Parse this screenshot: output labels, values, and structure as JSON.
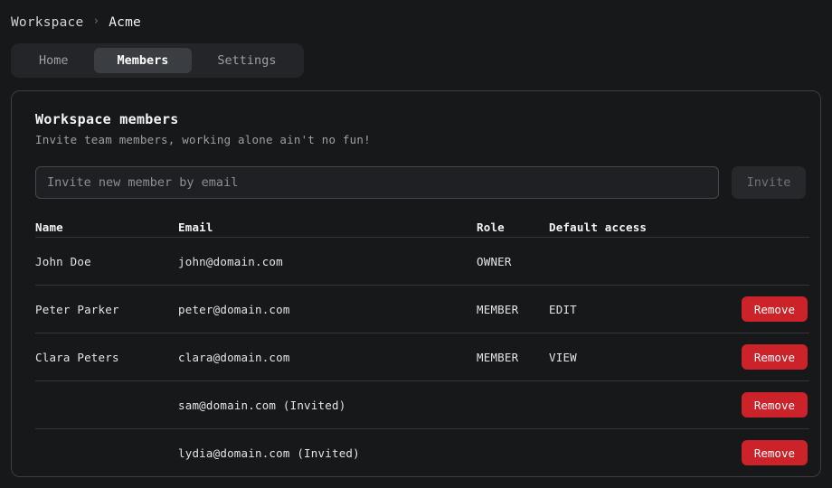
{
  "breadcrumb": {
    "root": "Workspace",
    "separator": "›",
    "current": "Acme"
  },
  "tabs": [
    {
      "label": "Home",
      "active": false
    },
    {
      "label": "Members",
      "active": true
    },
    {
      "label": "Settings",
      "active": false
    }
  ],
  "card": {
    "title": "Workspace members",
    "subtitle": "Invite team members, working alone ain't no fun!"
  },
  "invite": {
    "placeholder": "Invite new member by email",
    "value": "",
    "button_label": "Invite",
    "button_disabled": true
  },
  "table": {
    "headers": {
      "name": "Name",
      "email": "Email",
      "role": "Role",
      "access": "Default access",
      "action": ""
    },
    "rows": [
      {
        "name": "John Doe",
        "email": "john@domain.com",
        "role": "OWNER",
        "access": "",
        "action": ""
      },
      {
        "name": "Peter Parker",
        "email": "peter@domain.com",
        "role": "MEMBER",
        "access": "EDIT",
        "action": "Remove"
      },
      {
        "name": "Clara Peters",
        "email": "clara@domain.com",
        "role": "MEMBER",
        "access": "VIEW",
        "action": "Remove"
      },
      {
        "name": "",
        "email": "sam@domain.com (Invited)",
        "role": "",
        "access": "",
        "action": "Remove"
      },
      {
        "name": "",
        "email": "lydia@domain.com (Invited)",
        "role": "",
        "access": "",
        "action": "Remove"
      }
    ]
  },
  "colors": {
    "page_background": "#17181a",
    "card_border": "#3a3d42",
    "tabbar_background": "#232528",
    "tab_active_background": "#3a3d42",
    "remove_button": "#cc2229",
    "muted_text": "#9aa0a6",
    "divider": "#33363b"
  }
}
